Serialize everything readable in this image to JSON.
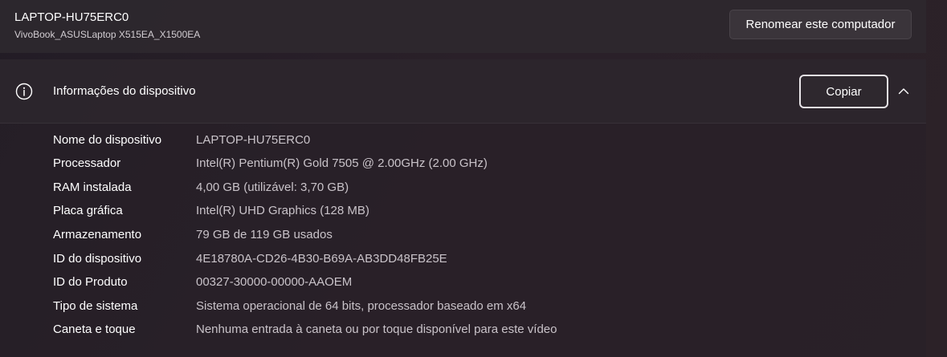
{
  "header": {
    "device_name": "LAPTOP-HU75ERC0",
    "device_model": "VivoBook_ASUSLaptop X515EA_X1500EA",
    "rename_label": "Renomear este computador"
  },
  "device_info": {
    "title": "Informações do dispositivo",
    "icon": "info-icon",
    "copy_label": "Copiar",
    "expanded": true,
    "rows": [
      {
        "label": "Nome do dispositivo",
        "value": "LAPTOP-HU75ERC0"
      },
      {
        "label": "Processador",
        "value": "Intel(R) Pentium(R) Gold 7505 @ 2.00GHz (2.00 GHz)"
      },
      {
        "label": "RAM instalada",
        "value": "4,00 GB (utilizável: 3,70 GB)"
      },
      {
        "label": "Placa gráfica",
        "value": "Intel(R) UHD Graphics (128 MB)"
      },
      {
        "label": "Armazenamento",
        "value": "79 GB de 119 GB usados"
      },
      {
        "label": "ID do dispositivo",
        "value": "4E18780A-CD26-4B30-B69A-AB3DD48FB25E"
      },
      {
        "label": "ID do Produto",
        "value": "00327-30000-00000-AAOEM"
      },
      {
        "label": "Tipo de sistema",
        "value": "Sistema operacional de 64 bits, processador baseado em x64"
      },
      {
        "label": "Caneta e toque",
        "value": "Nenhuma entrada à caneta ou por toque disponível para este vídeo"
      }
    ]
  },
  "colors": {
    "accent_border": "#e8e4e8",
    "value_text": "#c9c3c9"
  }
}
